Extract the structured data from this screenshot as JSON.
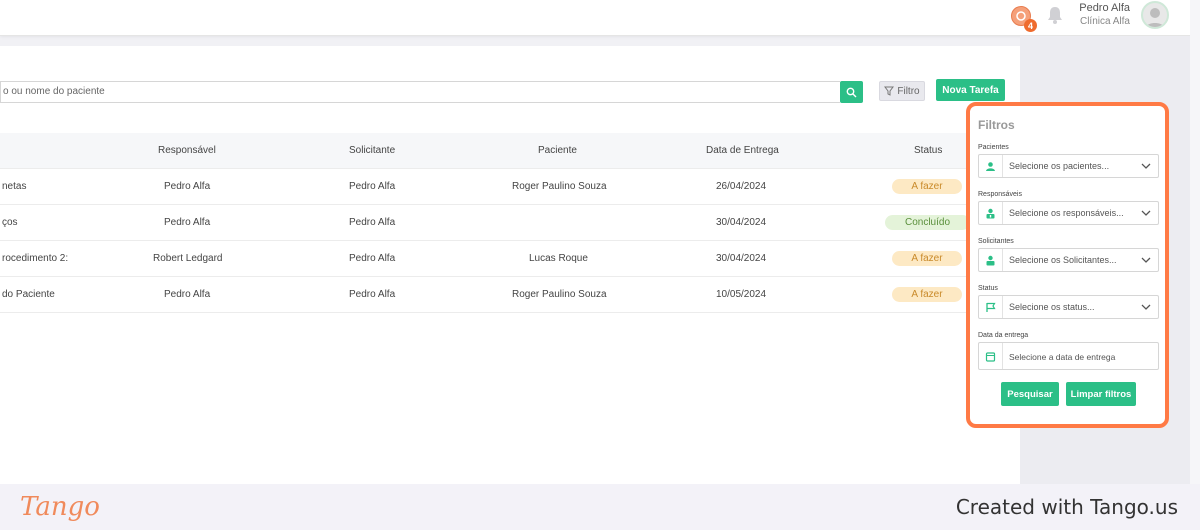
{
  "header": {
    "notification_count": "4",
    "user_name": "Pedro Alfa",
    "clinic": "Clínica Alfa"
  },
  "toolbar": {
    "search_placeholder": "o ou nome do paciente",
    "filter_label": "Filtro",
    "new_task_label": "Nova Tarefa"
  },
  "table": {
    "columns": [
      "Responsável",
      "Solicitante",
      "Paciente",
      "Data de Entrega",
      "Status"
    ],
    "rows": [
      {
        "task": "netas",
        "responsavel": "Pedro Alfa",
        "solicitante": "Pedro Alfa",
        "paciente": "Roger Paulino Souza",
        "data": "26/04/2024",
        "status": "A fazer"
      },
      {
        "task": "ços",
        "responsavel": "Pedro Alfa",
        "solicitante": "Pedro Alfa",
        "paciente": "",
        "data": "30/04/2024",
        "status": "Concluído"
      },
      {
        "task": "rocedimento 2:",
        "responsavel": "Robert Ledgard",
        "solicitante": "Pedro Alfa",
        "paciente": "Lucas Roque",
        "data": "30/04/2024",
        "status": "A fazer"
      },
      {
        "task": "do Paciente",
        "responsavel": "Pedro Alfa",
        "solicitante": "Pedro Alfa",
        "paciente": "Roger Paulino Souza",
        "data": "10/05/2024",
        "status": "A fazer"
      }
    ]
  },
  "filters": {
    "title": "Filtros",
    "pacientes_label": "Pacientes",
    "pacientes_placeholder": "Selecione os pacientes...",
    "responsaveis_label": "Responsáveis",
    "responsaveis_placeholder": "Selecione os responsáveis...",
    "solicitantes_label": "Solicitantes",
    "solicitantes_placeholder": "Selecione os Solicitantes...",
    "status_label": "Status",
    "status_placeholder": "Selecione os status...",
    "data_label": "Data da entrega",
    "data_placeholder": "Selecione a data de entrega",
    "search_button": "Pesquisar",
    "clear_button": "Limpar filtros"
  },
  "footer": {
    "logo_text": "Tango",
    "credit": "Created with Tango.us"
  },
  "colors": {
    "accent_green": "#2bbf87",
    "highlight_orange": "#ff7a45",
    "status_todo_bg": "#fde9c4",
    "status_done_bg": "#e4f3d9"
  }
}
